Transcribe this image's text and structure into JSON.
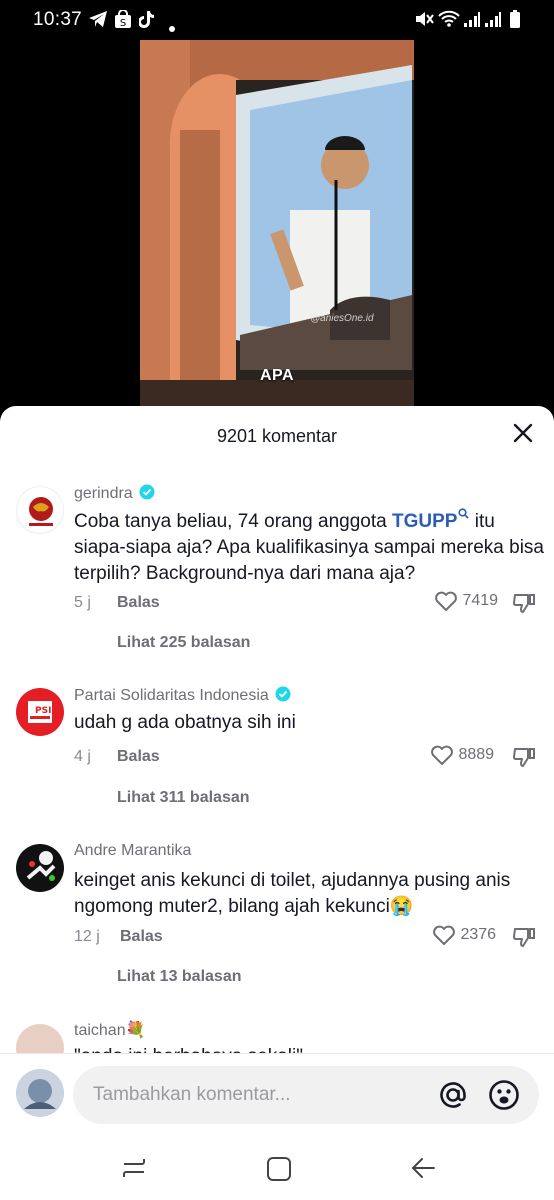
{
  "status_bar": {
    "time": "10:37"
  },
  "video": {
    "caption": "APA",
    "watermark": "@aniesOne.id"
  },
  "sheet": {
    "title": "9201 komentar"
  },
  "comments": [
    {
      "username": "gerindra",
      "verified": true,
      "text_before": "Coba tanya beliau, 74 orang anggota ",
      "tag": "TGUPP",
      "text_after": " itu siapa-siapa aja? Apa kualifikasinya sampai mereka bisa terpilih? Background-nya dari mana aja?",
      "time": "5 j",
      "reply_label": "Balas",
      "likes": "7419",
      "view_replies": "Lihat 225 balasan"
    },
    {
      "username": "Partai Solidaritas Indonesia",
      "verified": true,
      "text": "udah g ada obatnya sih ini",
      "time": "4 j",
      "reply_label": "Balas",
      "likes": "8889",
      "view_replies": "Lihat 311 balasan"
    },
    {
      "username": "Andre Marantika",
      "verified": false,
      "text": "keinget anis kekunci di toilet, ajudannya pusing anis ngomong muter2, bilang ajah kekunci😭",
      "time": "12 j",
      "reply_label": "Balas",
      "likes": "2376",
      "view_replies": "Lihat 13 balasan"
    },
    {
      "username": "taichan💐",
      "text": "\"anda ini berbahaya sekali\""
    }
  ],
  "input": {
    "placeholder": "Tambahkan komentar..."
  },
  "colors": {
    "accent_link": "#2b5db8",
    "verified": "#20d5ec",
    "text": "#161823",
    "muted": "#6e6f75"
  }
}
